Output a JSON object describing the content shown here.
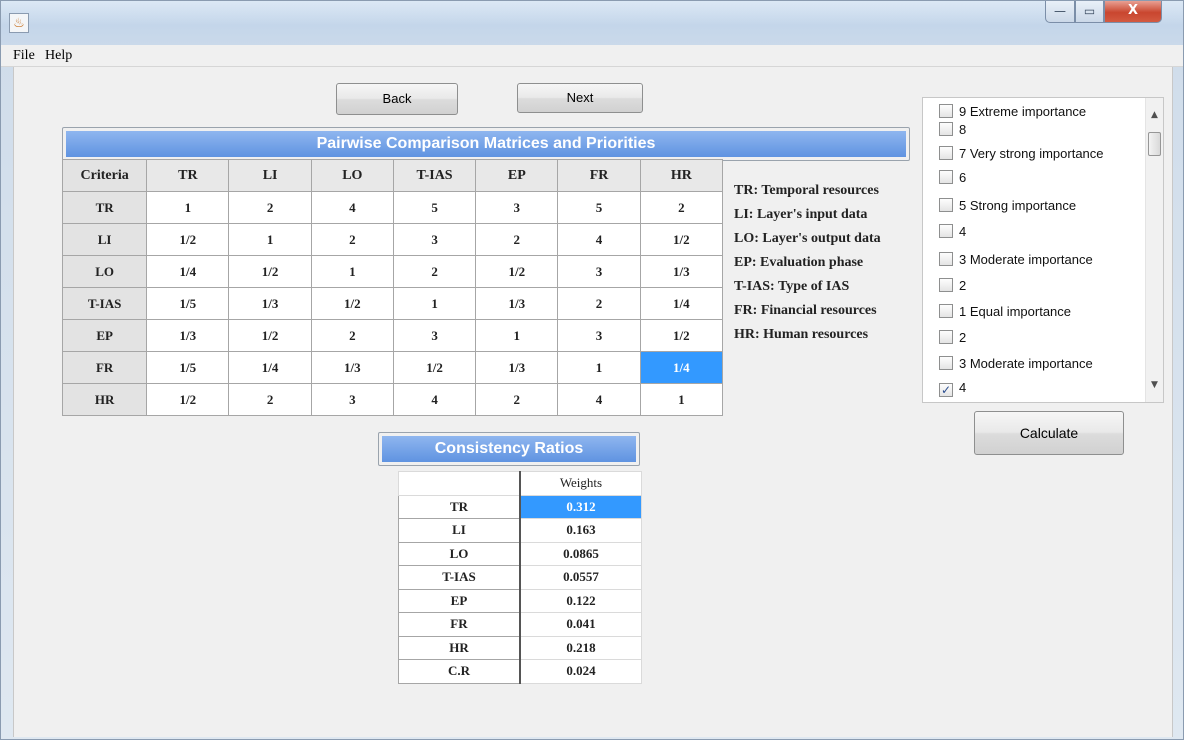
{
  "window": {
    "app_icon": "java-icon"
  },
  "titlebar_buttons": {
    "minimize": "—",
    "maximize": "▭",
    "close": "X"
  },
  "menu": {
    "file": "File",
    "help": "Help"
  },
  "nav": {
    "back": "Back",
    "next": "Next"
  },
  "matrix": {
    "title": "Pairwise Comparison Matrices and Priorities",
    "corner": "Criteria",
    "columns": [
      "TR",
      "LI",
      "LO",
      "T-IAS",
      "EP",
      "FR",
      "HR"
    ],
    "rows": [
      {
        "label": "TR",
        "cells": [
          "1",
          "2",
          "4",
          "5",
          "3",
          "5",
          "2"
        ]
      },
      {
        "label": "LI",
        "cells": [
          "1/2",
          "1",
          "2",
          "3",
          "2",
          "4",
          "1/2"
        ]
      },
      {
        "label": "LO",
        "cells": [
          "1/4",
          "1/2",
          "1",
          "2",
          "1/2",
          "3",
          "1/3"
        ]
      },
      {
        "label": "T-IAS",
        "cells": [
          "1/5",
          "1/3",
          "1/2",
          "1",
          "1/3",
          "2",
          "1/4"
        ]
      },
      {
        "label": "EP",
        "cells": [
          "1/3",
          "1/2",
          "2",
          "3",
          "1",
          "3",
          "1/2"
        ]
      },
      {
        "label": "FR",
        "cells": [
          "1/5",
          "1/4",
          "1/3",
          "1/2",
          "1/3",
          "1",
          "1/4"
        ]
      },
      {
        "label": "HR",
        "cells": [
          "1/2",
          "2",
          "3",
          "4",
          "2",
          "4",
          "1"
        ]
      }
    ],
    "selected_color": "#3399ff"
  },
  "legend": [
    "TR: Temporal resources",
    "LI: Layer's input data",
    "LO: Layer's output data",
    "EP: Evaluation phase",
    "T-IAS: Type of IAS",
    "FR: Financial resources",
    "HR: Human resources"
  ],
  "importance_list": [
    {
      "label": "9  Extreme importance",
      "checked": false
    },
    {
      "label": "8",
      "checked": false
    },
    {
      "label": "7 Very strong importance",
      "checked": false
    },
    {
      "label": "6",
      "checked": false
    },
    {
      "label": "5  Strong importance",
      "checked": false
    },
    {
      "label": "4",
      "checked": false
    },
    {
      "label": "3  Moderate importance",
      "checked": false
    },
    {
      "label": "2",
      "checked": false
    },
    {
      "label": "1  Equal importance",
      "checked": false
    },
    {
      "label": "2",
      "checked": false
    },
    {
      "label": "3  Moderate importance",
      "checked": false
    },
    {
      "label": "4",
      "checked": true
    }
  ],
  "calculate": "Calculate",
  "consistency": {
    "title": "Consistency Ratios",
    "weights_header": "Weights",
    "rows": [
      {
        "label": "TR",
        "value": "0.312"
      },
      {
        "label": "LI",
        "value": "0.163"
      },
      {
        "label": "LO",
        "value": "0.0865"
      },
      {
        "label": "T-IAS",
        "value": "0.0557"
      },
      {
        "label": "EP",
        "value": "0.122"
      },
      {
        "label": "FR",
        "value": "0.041"
      },
      {
        "label": "HR",
        "value": "0.218"
      },
      {
        "label": "C.R",
        "value": "0.024"
      }
    ]
  }
}
